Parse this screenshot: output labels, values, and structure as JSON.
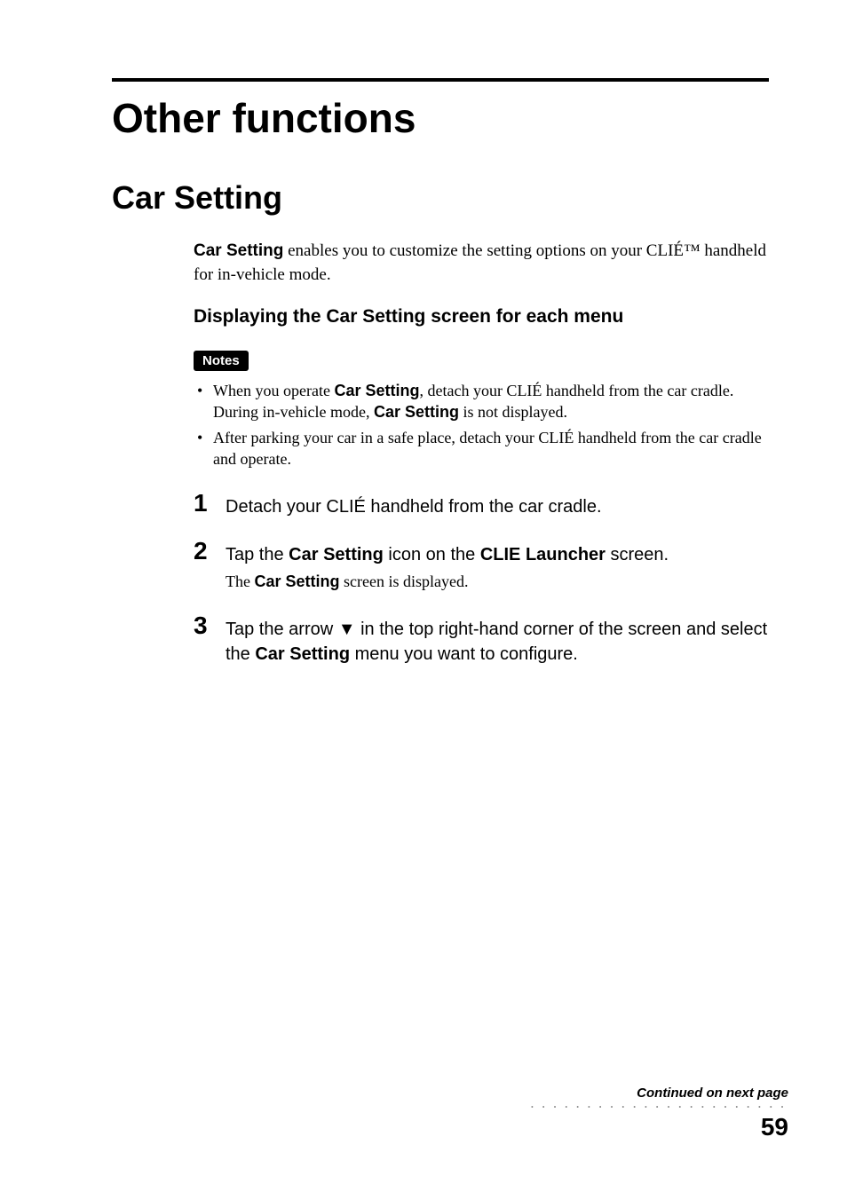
{
  "main_title": "Other functions",
  "section_title": "Car Setting",
  "intro": {
    "lead_bold": "Car Setting",
    "rest": " enables you to customize the setting options on your CLIÉ™ handheld for in-vehicle mode."
  },
  "subheading": "Displaying the Car Setting screen for each menu",
  "notes_label": "Notes",
  "notes": [
    {
      "pre": "When you operate ",
      "bold1": "Car Setting",
      "mid": ", detach your CLIÉ handheld from the car cradle. During in-vehicle mode, ",
      "bold2": "Car Setting",
      "post": " is not displayed."
    },
    {
      "pre": "After parking your car in a safe place, detach your CLIÉ handheld from the car cradle and operate.",
      "bold1": "",
      "mid": "",
      "bold2": "",
      "post": ""
    }
  ],
  "steps": [
    {
      "num": "1",
      "main_pre": "Detach your CLIÉ handheld from the car cradle.",
      "main_bold1": "",
      "main_mid": "",
      "main_bold2": "",
      "main_post": "",
      "sub_pre": "",
      "sub_bold": "",
      "sub_post": ""
    },
    {
      "num": "2",
      "main_pre": "Tap the ",
      "main_bold1": "Car Setting",
      "main_mid": " icon on the ",
      "main_bold2": "CLIE Launcher",
      "main_post": " screen.",
      "sub_pre": "The ",
      "sub_bold": "Car Setting",
      "sub_post": " screen is displayed."
    },
    {
      "num": "3",
      "main_pre": "Tap the arrow ",
      "main_bold1": "",
      "main_mid": "",
      "main_bold2": "",
      "main_post": "",
      "arrow": "▼",
      "main_after_arrow_pre": " in the top right-hand corner of the screen and select the ",
      "main_after_arrow_bold": "Car Setting",
      "main_after_arrow_post": " menu you want to configure.",
      "sub_pre": "",
      "sub_bold": "",
      "sub_post": ""
    }
  ],
  "footer": {
    "continued": "Continued on next page",
    "dots": "• • • • • • • • • • • • • • • • • • • • • • • • • • • • • • •",
    "page": "59"
  }
}
